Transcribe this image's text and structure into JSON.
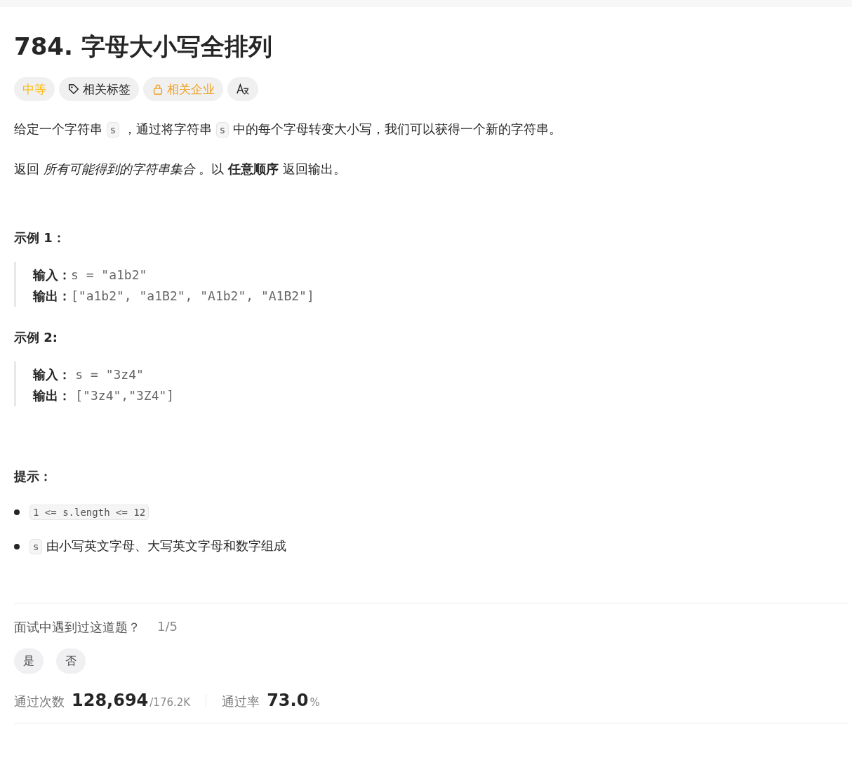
{
  "title": "784. 字母大小写全排列",
  "tags": [
    {
      "kind": "difficulty",
      "label": "中等"
    },
    {
      "kind": "topics",
      "label": "相关标签"
    },
    {
      "kind": "companies",
      "label": "相关企业"
    },
    {
      "kind": "translate"
    }
  ],
  "description": [
    [
      {
        "kind": "text",
        "text": "给定一个字符串 "
      },
      {
        "kind": "code",
        "text": "s"
      },
      {
        "kind": "text",
        "text": " ，通过将字符串 "
      },
      {
        "kind": "code",
        "text": "s"
      },
      {
        "kind": "text",
        "text": " 中的每个字母转变大小写，我们可以获得一个新的字符串。"
      }
    ],
    [
      {
        "kind": "text",
        "text": "返回 *所有可能得到的字符串集合* 。以 **任意顺序** 返回输出。"
      }
    ]
  ],
  "examples": [
    {
      "title": "示例 1：",
      "lines": [
        {
          "label": "输入：",
          "value": "s = \"a1b2\""
        },
        {
          "label": "输出：",
          "value": "[\"a1b2\", \"a1B2\", \"A1b2\", \"A1B2\"]"
        }
      ]
    },
    {
      "title": "示例 2:",
      "lines": [
        {
          "label": "输入： ",
          "value": "s = \"3z4\""
        },
        {
          "label": "输出： ",
          "value": "[\"3z4\",\"3Z4\"]"
        }
      ]
    }
  ],
  "constraints_title": "提示：",
  "constraints": [
    [
      {
        "kind": "code",
        "text": "1 <= s.length <= 12"
      }
    ],
    [
      {
        "kind": "code",
        "text": "s"
      },
      {
        "kind": "text",
        "text": " 由小写英文字母、大写英文字母和数字组成"
      }
    ]
  ],
  "interview": {
    "question": "面试中遇到过这道题？",
    "count": "1/5",
    "answers": [
      "是",
      "否"
    ]
  },
  "stats": [
    {
      "label": "通过次数",
      "value": "128,694",
      "suffix": "/176.2K"
    },
    {
      "label": "通过率",
      "value": "73.0",
      "suffix": "%"
    }
  ]
}
